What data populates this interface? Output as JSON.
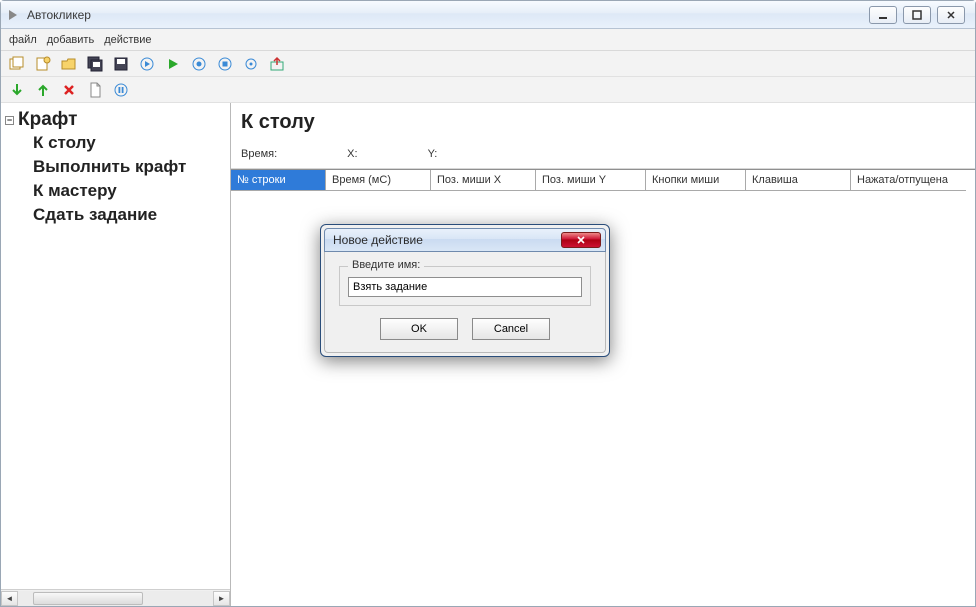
{
  "window": {
    "title": "Автокликер"
  },
  "menu": {
    "file": "файл",
    "add": "добавить",
    "action": "действие"
  },
  "tree": {
    "root": "Крафт",
    "items": [
      "К столу",
      "Выполнить крафт",
      "К мастеру",
      "Сдать задание"
    ]
  },
  "content": {
    "title": "К столу",
    "time_label": "Время:",
    "x_label": "X:",
    "y_label": "Y:"
  },
  "grid": {
    "headers": [
      "№ строки",
      "Время (мС)",
      "Поз. миши X",
      "Поз. миши Y",
      "Кнопки миши",
      "Клавиша",
      "Нажата/отпущена"
    ]
  },
  "dialog": {
    "title": "Новое действие",
    "prompt": "Введите имя:",
    "value": "Взять задание",
    "ok": "OK",
    "cancel": "Cancel"
  }
}
